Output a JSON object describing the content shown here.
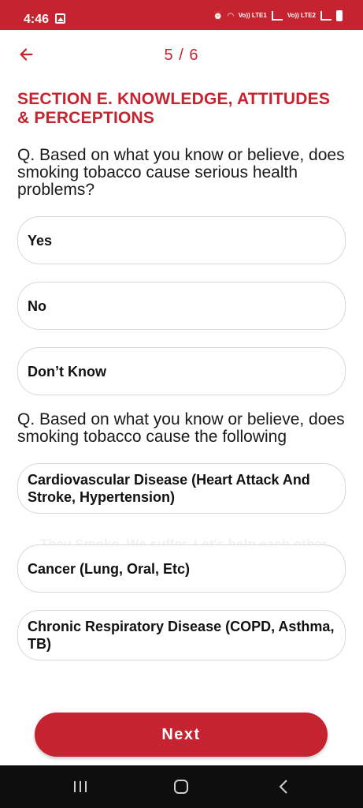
{
  "status_bar": {
    "time": "4:46",
    "net1": "Vo)) LTE1",
    "net2": "Vo)) LTE2"
  },
  "header": {
    "page_counter": "5 / 6"
  },
  "section": {
    "title": "SECTION E. KNOWLEDGE, ATTITUDES & PERCEPTIONS"
  },
  "q1": {
    "text": "Q. Based on what you know or believe, does smoking tobacco cause serious health problems?",
    "options": [
      "Yes",
      "No",
      "Don’t Know"
    ]
  },
  "q2": {
    "text": "Q. Based on what you know or believe, does smoking tobacco cause the following",
    "options": [
      "Cardiovascular Disease (Heart Attack And Stroke, Hypertension)",
      "Cancer (Lung, Oral, Etc)",
      "Chronic Respiratory Disease (COPD, Asthma, TB)"
    ]
  },
  "watermark": "They Smoke, We suffer. Let's help each other.",
  "footer": {
    "next_label": "Next"
  },
  "colors": {
    "accent": "#c5232f",
    "nav_bar": "#0e0e0e"
  }
}
